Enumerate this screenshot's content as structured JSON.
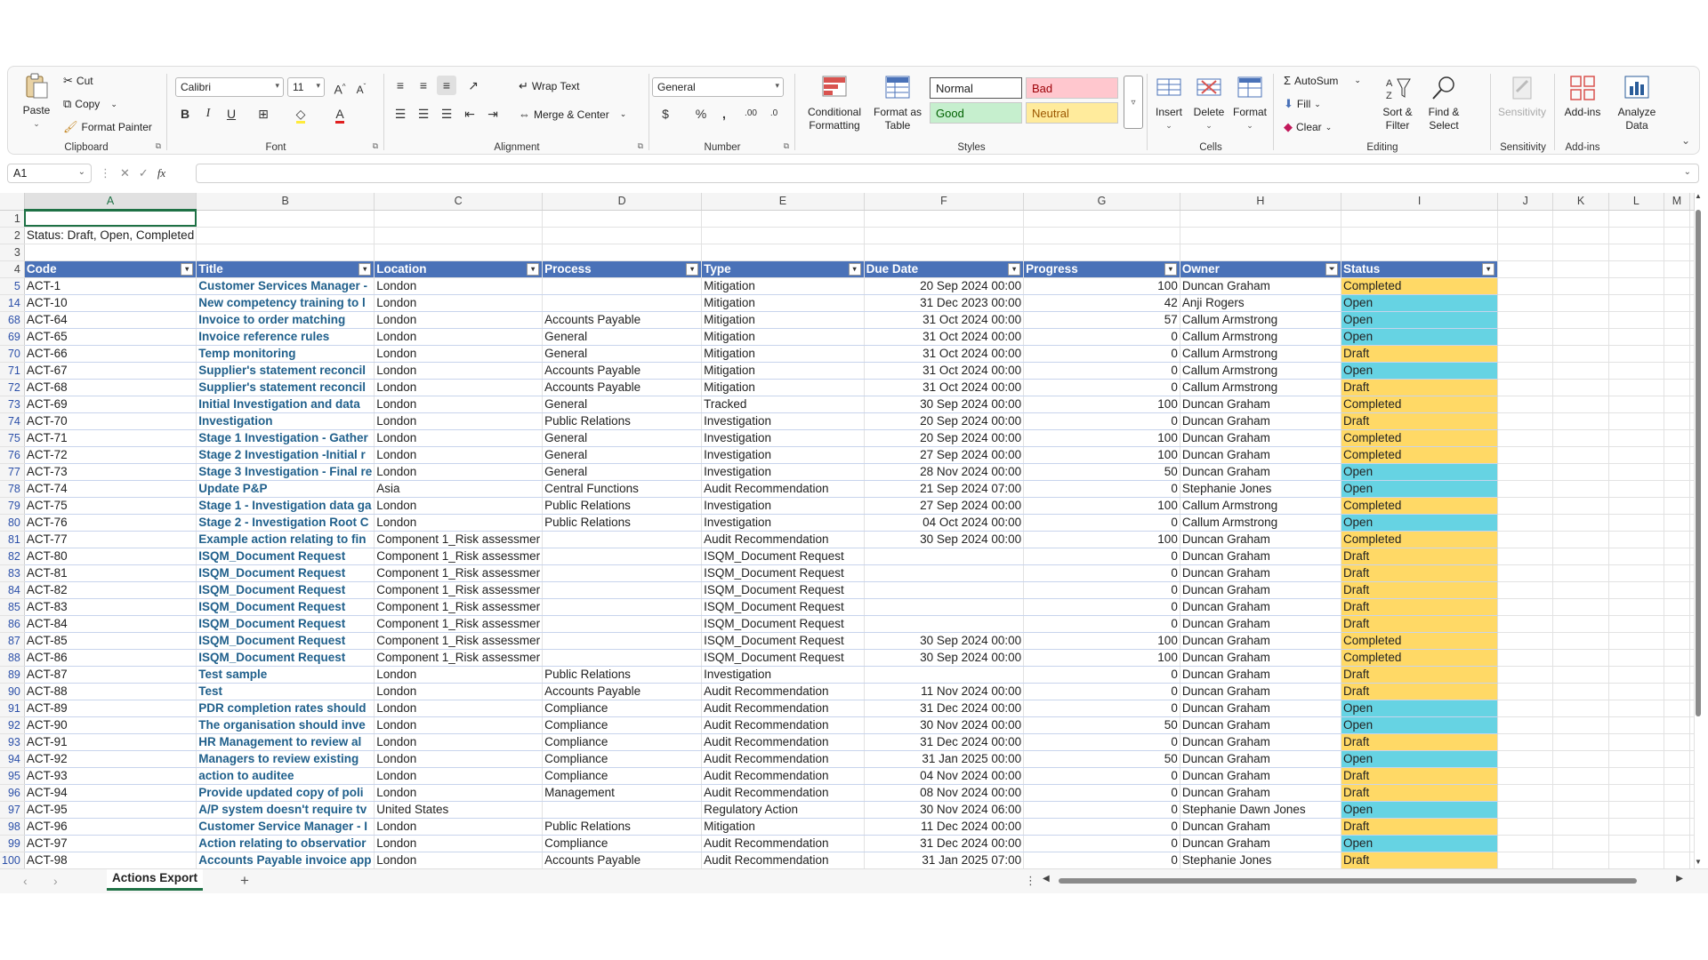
{
  "ribbon": {
    "clipboard": {
      "label": "Clipboard",
      "paste": "Paste",
      "cut": "Cut",
      "copy": "Copy",
      "format_painter": "Format Painter"
    },
    "font": {
      "label": "Font",
      "family": "Calibri",
      "size": "11"
    },
    "alignment": {
      "label": "Alignment",
      "wrap_text": "Wrap Text",
      "merge_center": "Merge & Center"
    },
    "number": {
      "label": "Number",
      "format": "General"
    },
    "styles": {
      "label": "Styles",
      "conditional_formatting": "Conditional Formatting",
      "format_as_table": "Format as Table",
      "normal": "Normal",
      "bad": "Bad",
      "good": "Good",
      "neutral": "Neutral"
    },
    "cells": {
      "label": "Cells",
      "insert": "Insert",
      "delete": "Delete",
      "format": "Format"
    },
    "editing": {
      "label": "Editing",
      "autosum": "AutoSum",
      "fill": "Fill",
      "clear": "Clear",
      "sort_filter": "Sort & Filter",
      "find_select": "Find & Select"
    },
    "sensitivity": {
      "label": "Sensitivity",
      "button": "Sensitivity"
    },
    "addins": {
      "label": "Add-ins",
      "button": "Add-ins",
      "analyze": "Analyze Data"
    }
  },
  "formula_bar": {
    "name_box": "A1",
    "fx": "fx",
    "value": ""
  },
  "columns": [
    "A",
    "B",
    "C",
    "D",
    "E",
    "F",
    "G",
    "H",
    "I",
    "J",
    "K",
    "L",
    "M"
  ],
  "top_rows": [
    {
      "row": "1",
      "text": ""
    },
    {
      "row": "2",
      "text": "Status: Draft, Open, Completed"
    },
    {
      "row": "3",
      "text": ""
    }
  ],
  "table_header": {
    "row": "4",
    "cells": [
      "Code",
      "Title",
      "Location",
      "Process",
      "Type",
      "Due Date",
      "Progress",
      "Owner",
      "Status"
    ]
  },
  "rows": [
    {
      "r": "5",
      "code": "ACT-1",
      "title": "Customer Services Manager -",
      "loc": "London",
      "proc": "",
      "type": "Mitigation",
      "due": "20 Sep 2024 00:00",
      "prog": "100",
      "owner": "Duncan Graham",
      "status": "Completed"
    },
    {
      "r": "14",
      "code": "ACT-10",
      "title": "New competency training to l",
      "loc": "London",
      "proc": "",
      "type": "Mitigation",
      "due": "31 Dec 2023 00:00",
      "prog": "42",
      "owner": "Anji Rogers",
      "status": "Open"
    },
    {
      "r": "68",
      "code": "ACT-64",
      "title": "Invoice to order matching",
      "loc": "London",
      "proc": "Accounts Payable",
      "type": "Mitigation",
      "due": "31 Oct 2024 00:00",
      "prog": "57",
      "owner": "Callum Armstrong",
      "status": "Open"
    },
    {
      "r": "69",
      "code": "ACT-65",
      "title": "Invoice reference rules",
      "loc": "London",
      "proc": "General",
      "type": "Mitigation",
      "due": "31 Oct 2024 00:00",
      "prog": "0",
      "owner": "Callum Armstrong",
      "status": "Open"
    },
    {
      "r": "70",
      "code": "ACT-66",
      "title": "Temp monitoring",
      "loc": "London",
      "proc": "General",
      "type": "Mitigation",
      "due": "31 Oct 2024 00:00",
      "prog": "0",
      "owner": "Callum Armstrong",
      "status": "Draft"
    },
    {
      "r": "71",
      "code": "ACT-67",
      "title": "Supplier's statement reconcil",
      "loc": "London",
      "proc": "Accounts Payable",
      "type": "Mitigation",
      "due": "31 Oct 2024 00:00",
      "prog": "0",
      "owner": "Callum Armstrong",
      "status": "Open"
    },
    {
      "r": "72",
      "code": "ACT-68",
      "title": "Supplier's statement reconcil",
      "loc": "London",
      "proc": "Accounts Payable",
      "type": "Mitigation",
      "due": "31 Oct 2024 00:00",
      "prog": "0",
      "owner": "Callum Armstrong",
      "status": "Draft"
    },
    {
      "r": "73",
      "code": "ACT-69",
      "title": "Initial Investigation and data",
      "loc": "London",
      "proc": "General",
      "type": "Tracked",
      "due": "30 Sep 2024 00:00",
      "prog": "100",
      "owner": "Duncan Graham",
      "status": "Completed"
    },
    {
      "r": "74",
      "code": "ACT-70",
      "title": "Investigation",
      "loc": "London",
      "proc": "Public Relations",
      "type": "Investigation",
      "due": "20 Sep 2024 00:00",
      "prog": "0",
      "owner": "Duncan Graham",
      "status": "Draft"
    },
    {
      "r": "75",
      "code": "ACT-71",
      "title": "Stage 1 Investigation - Gather",
      "loc": "London",
      "proc": "General",
      "type": "Investigation",
      "due": "20 Sep 2024 00:00",
      "prog": "100",
      "owner": "Duncan Graham",
      "status": "Completed"
    },
    {
      "r": "76",
      "code": "ACT-72",
      "title": "Stage 2 Investigation -Initial r",
      "loc": "London",
      "proc": "General",
      "type": "Investigation",
      "due": "27 Sep 2024 00:00",
      "prog": "100",
      "owner": "Duncan Graham",
      "status": "Completed"
    },
    {
      "r": "77",
      "code": "ACT-73",
      "title": "Stage 3 Investigation - Final re",
      "loc": "London",
      "proc": "General",
      "type": "Investigation",
      "due": "28 Nov 2024 00:00",
      "prog": "50",
      "owner": "Duncan Graham",
      "status": "Open"
    },
    {
      "r": "78",
      "code": "ACT-74",
      "title": "Update P&P",
      "loc": "Asia",
      "proc": "Central Functions",
      "type": "Audit Recommendation",
      "due": "21 Sep 2024 07:00",
      "prog": "0",
      "owner": "Stephanie Jones",
      "status": "Open"
    },
    {
      "r": "79",
      "code": "ACT-75",
      "title": "Stage 1 - Investigation data ga",
      "loc": "London",
      "proc": "Public Relations",
      "type": "Investigation",
      "due": "27 Sep 2024 00:00",
      "prog": "100",
      "owner": "Callum Armstrong",
      "status": "Completed"
    },
    {
      "r": "80",
      "code": "ACT-76",
      "title": "Stage 2 - Investigation Root C",
      "loc": "London",
      "proc": "Public Relations",
      "type": "Investigation",
      "due": "04 Oct 2024 00:00",
      "prog": "0",
      "owner": "Callum Armstrong",
      "status": "Open"
    },
    {
      "r": "81",
      "code": "ACT-77",
      "title": "Example action relating to fin",
      "loc": "Component 1_Risk assessmer",
      "proc": "",
      "type": "Audit Recommendation",
      "due": "30 Sep 2024 00:00",
      "prog": "100",
      "owner": "Duncan Graham",
      "status": "Completed"
    },
    {
      "r": "82",
      "code": "ACT-80",
      "title": "ISQM_Document Request",
      "loc": "Component 1_Risk assessmer",
      "proc": "",
      "type": "ISQM_Document Request",
      "due": "",
      "prog": "0",
      "owner": "Duncan Graham",
      "status": "Draft"
    },
    {
      "r": "83",
      "code": "ACT-81",
      "title": "ISQM_Document Request",
      "loc": "Component 1_Risk assessmer",
      "proc": "",
      "type": "ISQM_Document Request",
      "due": "",
      "prog": "0",
      "owner": "Duncan Graham",
      "status": "Draft"
    },
    {
      "r": "84",
      "code": "ACT-82",
      "title": "ISQM_Document Request",
      "loc": "Component 1_Risk assessmer",
      "proc": "",
      "type": "ISQM_Document Request",
      "due": "",
      "prog": "0",
      "owner": "Duncan Graham",
      "status": "Draft"
    },
    {
      "r": "85",
      "code": "ACT-83",
      "title": "ISQM_Document Request",
      "loc": "Component 1_Risk assessmer",
      "proc": "",
      "type": "ISQM_Document Request",
      "due": "",
      "prog": "0",
      "owner": "Duncan Graham",
      "status": "Draft"
    },
    {
      "r": "86",
      "code": "ACT-84",
      "title": "ISQM_Document Request",
      "loc": "Component 1_Risk assessmer",
      "proc": "",
      "type": "ISQM_Document Request",
      "due": "",
      "prog": "0",
      "owner": "Duncan Graham",
      "status": "Draft"
    },
    {
      "r": "87",
      "code": "ACT-85",
      "title": "ISQM_Document Request",
      "loc": "Component 1_Risk assessmer",
      "proc": "",
      "type": "ISQM_Document Request",
      "due": "30 Sep 2024 00:00",
      "prog": "100",
      "owner": "Duncan Graham",
      "status": "Completed"
    },
    {
      "r": "88",
      "code": "ACT-86",
      "title": "ISQM_Document Request",
      "loc": "Component 1_Risk assessmer",
      "proc": "",
      "type": "ISQM_Document Request",
      "due": "30 Sep 2024 00:00",
      "prog": "100",
      "owner": "Duncan Graham",
      "status": "Completed"
    },
    {
      "r": "89",
      "code": "ACT-87",
      "title": "Test sample",
      "loc": "London",
      "proc": "Public Relations",
      "type": "Investigation",
      "due": "",
      "prog": "0",
      "owner": "Duncan Graham",
      "status": "Draft"
    },
    {
      "r": "90",
      "code": "ACT-88",
      "title": "Test",
      "loc": "London",
      "proc": "Accounts Payable",
      "type": "Audit Recommendation",
      "due": "11 Nov 2024 00:00",
      "prog": "0",
      "owner": "Duncan Graham",
      "status": "Draft"
    },
    {
      "r": "91",
      "code": "ACT-89",
      "title": "PDR completion rates should",
      "loc": "London",
      "proc": "Compliance",
      "type": "Audit Recommendation",
      "due": "31 Dec 2024 00:00",
      "prog": "0",
      "owner": "Duncan Graham",
      "status": "Open"
    },
    {
      "r": "92",
      "code": "ACT-90",
      "title": "The organisation should inve",
      "loc": "London",
      "proc": "Compliance",
      "type": "Audit Recommendation",
      "due": "30 Nov 2024 00:00",
      "prog": "50",
      "owner": "Duncan Graham",
      "status": "Open"
    },
    {
      "r": "93",
      "code": "ACT-91",
      "title": "HR Management to review al",
      "loc": "London",
      "proc": "Compliance",
      "type": "Audit Recommendation",
      "due": "31 Dec 2024 00:00",
      "prog": "0",
      "owner": "Duncan Graham",
      "status": "Draft"
    },
    {
      "r": "94",
      "code": "ACT-92",
      "title": "Managers to review existing",
      "loc": "London",
      "proc": "Compliance",
      "type": "Audit Recommendation",
      "due": "31 Jan 2025 00:00",
      "prog": "50",
      "owner": "Duncan Graham",
      "status": "Open"
    },
    {
      "r": "95",
      "code": "ACT-93",
      "title": "action to auditee",
      "loc": "London",
      "proc": "Compliance",
      "type": "Audit Recommendation",
      "due": "04 Nov 2024 00:00",
      "prog": "0",
      "owner": "Duncan Graham",
      "status": "Draft"
    },
    {
      "r": "96",
      "code": "ACT-94",
      "title": "Provide updated copy of poli",
      "loc": "London",
      "proc": "Management",
      "type": "Audit Recommendation",
      "due": "08 Nov 2024 00:00",
      "prog": "0",
      "owner": "Duncan Graham",
      "status": "Draft"
    },
    {
      "r": "97",
      "code": "ACT-95",
      "title": "A/P system doesn't require tv",
      "loc": "United States",
      "proc": "",
      "type": "Regulatory Action",
      "due": "30 Nov 2024 06:00",
      "prog": "0",
      "owner": "Stephanie Dawn Jones",
      "status": "Open"
    },
    {
      "r": "98",
      "code": "ACT-96",
      "title": "Customer Service Manager - I",
      "loc": "London",
      "proc": "Public Relations",
      "type": "Mitigation",
      "due": "11 Dec 2024 00:00",
      "prog": "0",
      "owner": "Duncan Graham",
      "status": "Draft"
    },
    {
      "r": "99",
      "code": "ACT-97",
      "title": "Action relating to observatior",
      "loc": "London",
      "proc": "Compliance",
      "type": "Audit Recommendation",
      "due": "31 Dec 2024 00:00",
      "prog": "0",
      "owner": "Duncan Graham",
      "status": "Open"
    },
    {
      "r": "100",
      "code": "ACT-98",
      "title": "Accounts Payable invoice app",
      "loc": "London",
      "proc": "Accounts Payable",
      "type": "Audit Recommendation",
      "due": "31 Jan 2025 07:00",
      "prog": "0",
      "owner": "Stephanie Jones",
      "status": "Draft"
    }
  ],
  "tabs": {
    "active": "Actions Export",
    "add": "+"
  },
  "colors": {
    "table_header": "#4a72b8",
    "status_completed": "#ffd966",
    "status_draft": "#ffd966",
    "status_open": "#66d3e3",
    "accent_green": "#1e7145"
  }
}
